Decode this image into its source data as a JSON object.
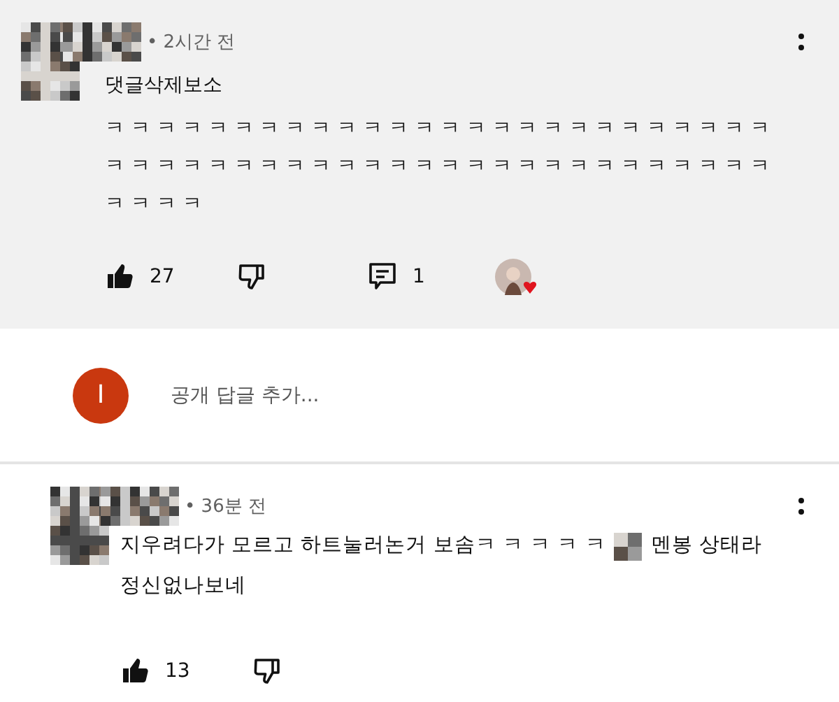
{
  "comments": [
    {
      "time": "• 2시간 전",
      "highlighted": true,
      "paragraphs": [
        [
          {
            "kind": "text",
            "text": "댓글삭제보소"
          }
        ],
        [
          {
            "kind": "text",
            "text": "ㅋ ㅋ ㅋ ㅋ ㅋ ㅋ ㅋ ㅋ ㅋ ㅋ ㅋ ㅋ ㅋ ㅋ ㅋ ㅋ ㅋ ㅋ ㅋ ㅋ ㅋ ㅋ ㅋ ㅋ ㅋ ㅋ"
          }
        ],
        [
          {
            "kind": "text",
            "text": "ㅋ ㅋ ㅋ ㅋ ㅋ ㅋ ㅋ ㅋ ㅋ ㅋ ㅋ ㅋ ㅋ ㅋ ㅋ ㅋ ㅋ ㅋ ㅋ ㅋ ㅋ ㅋ ㅋ ㅋ ㅋ ㅋ"
          }
        ],
        [
          {
            "kind": "text",
            "text": "ㅋ ㅋ ㅋ ㅋ"
          }
        ]
      ],
      "likes": "27",
      "replies": "1",
      "creator_heart": true,
      "reply_box": {
        "avatar_letter": "I",
        "placeholder": "공개 답글 추가..."
      }
    },
    {
      "time": "• 36분 전",
      "highlighted": false,
      "paragraphs": [
        [
          {
            "kind": "text",
            "text": "지우려다가 모르고 하트눌러논거 보솜ㅋ ㅋ ㅋ ㅋ ㅋ"
          },
          {
            "kind": "censored"
          },
          {
            "kind": "text",
            "text": "멘봉 상태라"
          }
        ],
        [
          {
            "kind": "text",
            "text": "정신없나보네"
          }
        ]
      ],
      "likes": "13",
      "creator_heart": false
    }
  ]
}
